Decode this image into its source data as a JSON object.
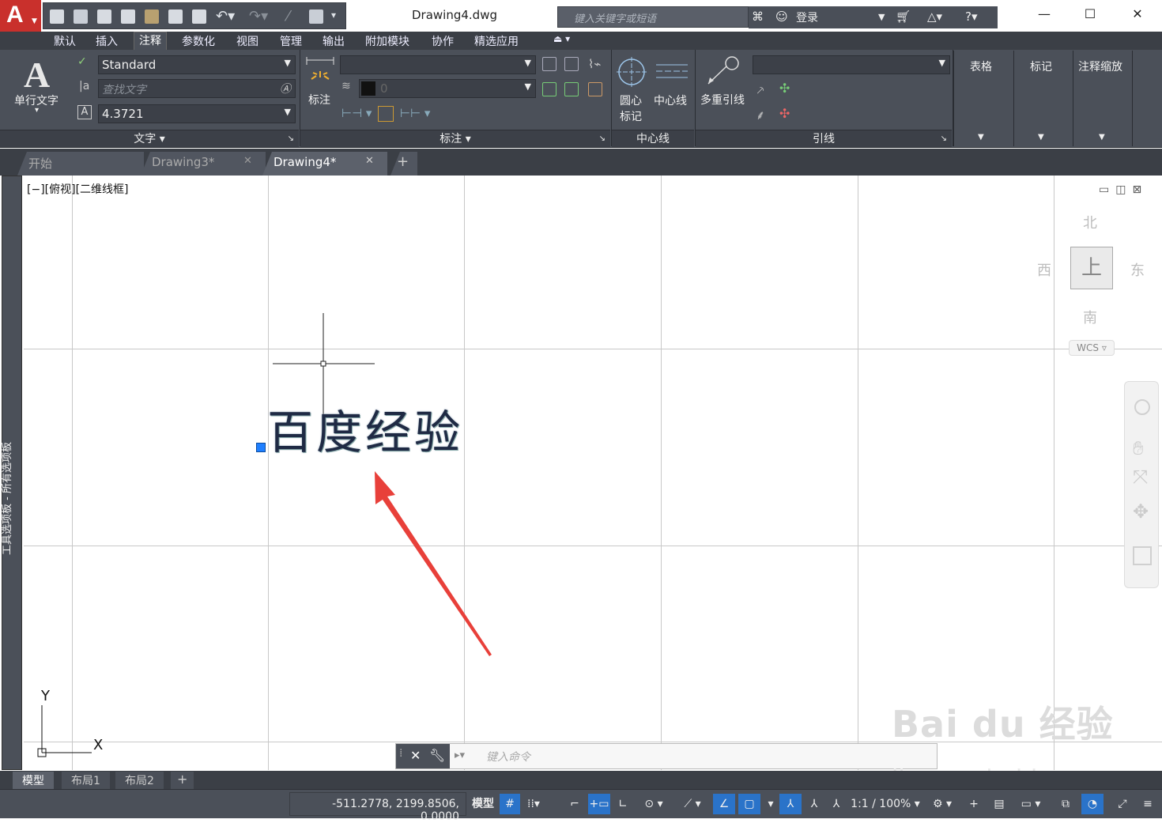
{
  "title_bar": {
    "document_title": "Drawing4.dwg",
    "search_placeholder": "键入关键字或短语",
    "login_label": "登录",
    "window_controls": [
      "—",
      "☐",
      "✕"
    ]
  },
  "menu_tabs": [
    "默认",
    "插入",
    "注释",
    "参数化",
    "视图",
    "管理",
    "输出",
    "附加模块",
    "协作",
    "精选应用"
  ],
  "active_menu_tab": "注释",
  "ribbon": {
    "text_panel": {
      "big_button_label": "单行文字",
      "style_value": "Standard",
      "find_placeholder": "查找文字",
      "height_value": "4.3721",
      "footer": "文字"
    },
    "dimension_panel": {
      "big_button_label": "标注",
      "layer_value": "0",
      "footer": "标注"
    },
    "centerline_panel": {
      "center_mark_label_1": "圆心",
      "center_mark_label_2": "标记",
      "centerline_label": "中心线",
      "footer": "中心线"
    },
    "leader_panel": {
      "big_button_label": "多重引线",
      "footer": "引线"
    },
    "table_panel": {
      "label": "表格"
    },
    "markup_panel": {
      "label": "标记"
    },
    "scale_panel": {
      "label": "注释缩放"
    }
  },
  "doc_tabs": [
    {
      "label": "开始",
      "active": false
    },
    {
      "label": "Drawing3*",
      "active": false
    },
    {
      "label": "Drawing4*",
      "active": true
    }
  ],
  "viewport": {
    "label": "[−][俯视][二维线框]",
    "text_object": "百度经验",
    "ucs_y": "Y",
    "ucs_x": "X"
  },
  "tool_palette_label": "工具选项板 - 所有选项板",
  "viewcube": {
    "north": "北",
    "south": "南",
    "east": "东",
    "west": "西",
    "face": "上",
    "wcs": "WCS"
  },
  "command_line": {
    "placeholder": "键入命令"
  },
  "layout_tabs": [
    "模型",
    "布局1",
    "布局2"
  ],
  "status_bar": {
    "coordinates": "-511.2778, 2199.8506, 0.0000",
    "model_label": "模型",
    "scale_label": "1:1 / 100%"
  },
  "watermark": {
    "brand": "Bai du 经验",
    "url": "jingyan.baidu.com"
  },
  "colors": {
    "ribbon_bg": "#4b5059",
    "accent_blue": "#2a73c9",
    "logo_red": "#c9302c",
    "annotation_arrow": "#e8403a"
  }
}
